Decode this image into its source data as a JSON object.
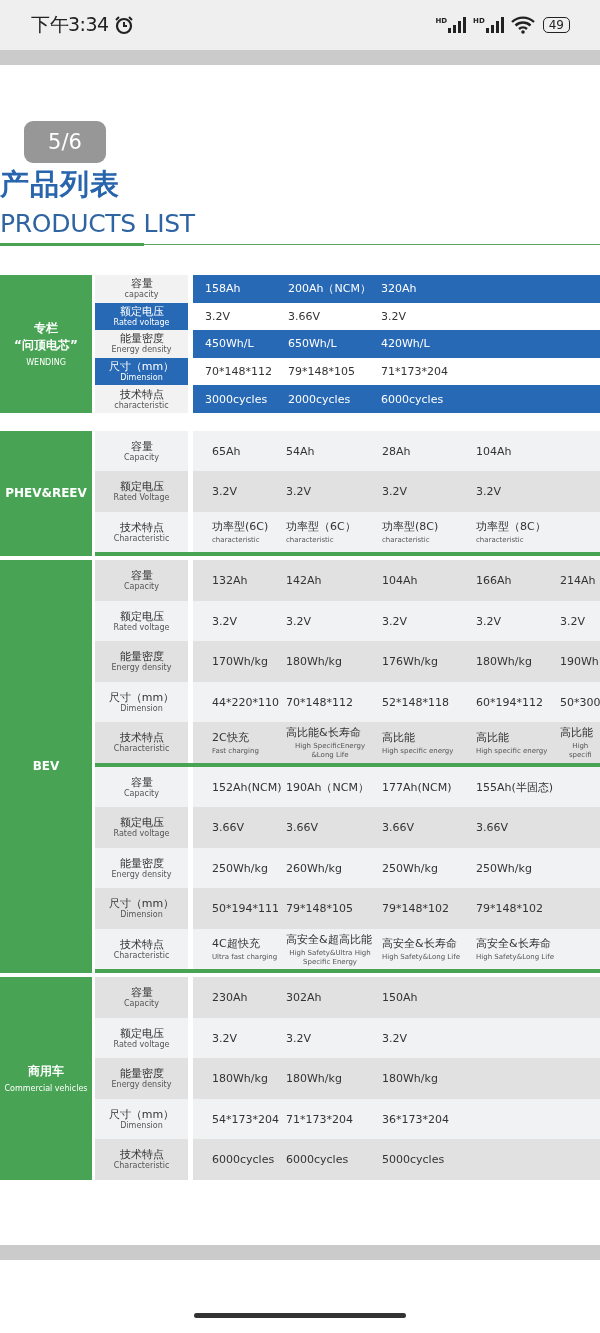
{
  "status_bar": {
    "time": "下午3:34",
    "signal_labels": [
      "HD",
      "HD"
    ],
    "battery": "49"
  },
  "page_badge": "5/6",
  "title_zh": "产品列表",
  "title_en": "PRODUCTS LIST",
  "sections": [
    {
      "kind": "highlight",
      "title_lines": [
        {
          "text": "专栏",
          "kind": "main"
        },
        {
          "text": "“问顶电芯”",
          "kind": "main"
        },
        {
          "text": "WENDING",
          "kind": "sub"
        }
      ],
      "groups": [
        [
          {
            "label": "容量",
            "label_en": "capacity",
            "kind": "blue-values",
            "cells": [
              {
                "value": "158Ah"
              },
              {
                "value": "200Ah（NCM）"
              },
              {
                "value": "320Ah"
              }
            ]
          },
          {
            "label": "额定电压",
            "label_en": "Rated voltage",
            "kind": "blue-label",
            "cells": [
              {
                "value": "3.2V"
              },
              {
                "value": "3.66V"
              },
              {
                "value": "3.2V"
              }
            ]
          },
          {
            "label": "能量密度",
            "label_en": "Energy density",
            "kind": "blue-values",
            "cells": [
              {
                "value": "450Wh/L"
              },
              {
                "value": "650Wh/L"
              },
              {
                "value": "420Wh/L"
              }
            ]
          },
          {
            "label": "尺寸（mm）",
            "label_en": "Dimension",
            "kind": "blue-label",
            "cells": [
              {
                "value": "70*148*112"
              },
              {
                "value": "79*148*105"
              },
              {
                "value": "71*173*204"
              }
            ]
          },
          {
            "label": "技术特点",
            "label_en": "characteristic",
            "kind": "blue-values",
            "cells": [
              {
                "value": "3000cycles"
              },
              {
                "value": "2000cycles"
              },
              {
                "value": "6000cycles"
              }
            ]
          }
        ]
      ]
    },
    {
      "kind": "plain",
      "title_lines": [
        {
          "text": "PHEV&REEV",
          "kind": "main"
        }
      ],
      "groups": [
        [
          {
            "label": "容量",
            "label_en": "Capacity",
            "kind": "light",
            "cells": [
              {
                "value": "65Ah"
              },
              {
                "value": "54Ah"
              },
              {
                "value": "28Ah"
              },
              {
                "value": "104Ah"
              }
            ]
          },
          {
            "label": "额定电压",
            "label_en": "Rated Voltage",
            "kind": "grey",
            "cells": [
              {
                "value": "3.2V"
              },
              {
                "value": "3.2V"
              },
              {
                "value": "3.2V"
              },
              {
                "value": "3.2V"
              }
            ]
          },
          {
            "label": "技术特点",
            "label_en": "Characteristic",
            "kind": "light",
            "cells": [
              {
                "value": "功率型(6C)",
                "note": "characteristic"
              },
              {
                "value": "功率型（6C）",
                "note": "characteristic"
              },
              {
                "value": "功率型(8C)",
                "note": "characteristic"
              },
              {
                "value": "功率型（8C）",
                "note": "characteristic"
              }
            ]
          }
        ]
      ]
    },
    {
      "kind": "plain",
      "title_lines": [
        {
          "text": "BEV",
          "kind": "main"
        }
      ],
      "groups": [
        [
          {
            "label": "容量",
            "label_en": "Capacity",
            "kind": "grey",
            "cells": [
              {
                "value": "132Ah"
              },
              {
                "value": "142Ah"
              },
              {
                "value": "104Ah"
              },
              {
                "value": "166Ah"
              },
              {
                "value": "214Ah"
              }
            ]
          },
          {
            "label": "额定电压",
            "label_en": "Rated voltage",
            "kind": "light",
            "cells": [
              {
                "value": "3.2V"
              },
              {
                "value": "3.2V"
              },
              {
                "value": "3.2V"
              },
              {
                "value": "3.2V"
              },
              {
                "value": "3.2V"
              }
            ]
          },
          {
            "label": "能量密度",
            "label_en": "Energy density",
            "kind": "grey",
            "cells": [
              {
                "value": "170Wh/kg"
              },
              {
                "value": "180Wh/kg"
              },
              {
                "value": "176Wh/kg"
              },
              {
                "value": "180Wh/kg"
              },
              {
                "value": "190Wh"
              }
            ]
          },
          {
            "label": "尺寸（mm）",
            "label_en": "Dimension",
            "kind": "light",
            "cells": [
              {
                "value": "44*220*110"
              },
              {
                "value": "70*148*112"
              },
              {
                "value": "52*148*118"
              },
              {
                "value": "60*194*112"
              },
              {
                "value": "50*300"
              }
            ]
          },
          {
            "label": "技术特点",
            "label_en": "Characteristic",
            "kind": "grey",
            "cells": [
              {
                "value": "2C快充",
                "note": "Fast charging"
              },
              {
                "value": "高比能&长寿命",
                "note": "High SpecificEnergy &Long Life"
              },
              {
                "value": "高比能",
                "note": "High specific energy"
              },
              {
                "value": "高比能",
                "note": "High specific energy"
              },
              {
                "value": "高比能",
                "note": "High specifi"
              }
            ]
          }
        ],
        [
          {
            "label": "容量",
            "label_en": "Capacity",
            "kind": "light",
            "cells": [
              {
                "value": "152Ah(NCM)"
              },
              {
                "value": "190Ah（NCM）"
              },
              {
                "value": "177Ah(NCM)"
              },
              {
                "value": "155Ah(半固态)"
              }
            ]
          },
          {
            "label": "额定电压",
            "label_en": "Rated voltage",
            "kind": "grey",
            "cells": [
              {
                "value": "3.66V"
              },
              {
                "value": "3.66V"
              },
              {
                "value": "3.66V"
              },
              {
                "value": "3.66V"
              }
            ]
          },
          {
            "label": "能量密度",
            "label_en": "Energy density",
            "kind": "light",
            "cells": [
              {
                "value": "250Wh/kg"
              },
              {
                "value": "260Wh/kg"
              },
              {
                "value": "250Wh/kg"
              },
              {
                "value": "250Wh/kg"
              }
            ]
          },
          {
            "label": "尺寸（mm）",
            "label_en": "Dimension",
            "kind": "grey",
            "cells": [
              {
                "value": "50*194*111"
              },
              {
                "value": "79*148*105"
              },
              {
                "value": "79*148*102"
              },
              {
                "value": "79*148*102"
              }
            ]
          },
          {
            "label": "技术特点",
            "label_en": "Characteristic",
            "kind": "light",
            "cells": [
              {
                "value": "4C超快充",
                "note": "Ultra fast charging"
              },
              {
                "value": "高安全&超高比能",
                "note": "High Safety&Ultra High Specific Energy"
              },
              {
                "value": "高安全&长寿命",
                "note": "High Safety&Long Life"
              },
              {
                "value": "高安全&长寿命",
                "note": "High Safety&Long Life"
              }
            ]
          }
        ]
      ]
    },
    {
      "kind": "plain",
      "title_lines": [
        {
          "text": "商用车",
          "kind": "main"
        },
        {
          "text": "Commercial vehicles",
          "kind": "sub"
        }
      ],
      "groups": [
        [
          {
            "label": "容量",
            "label_en": "Capacity",
            "kind": "grey",
            "cells": [
              {
                "value": "230Ah"
              },
              {
                "value": "302Ah"
              },
              {
                "value": "150Ah"
              }
            ]
          },
          {
            "label": "额定电压",
            "label_en": "Rated voltage",
            "kind": "light",
            "cells": [
              {
                "value": "3.2V"
              },
              {
                "value": "3.2V"
              },
              {
                "value": "3.2V"
              }
            ]
          },
          {
            "label": "能量密度",
            "label_en": "Energy density",
            "kind": "grey",
            "cells": [
              {
                "value": "180Wh/kg"
              },
              {
                "value": "180Wh/kg"
              },
              {
                "value": "180Wh/kg"
              }
            ]
          },
          {
            "label": "尺寸（mm）",
            "label_en": "Dimension",
            "kind": "light",
            "cells": [
              {
                "value": "54*173*204"
              },
              {
                "value": "71*173*204"
              },
              {
                "value": "36*173*204"
              }
            ]
          },
          {
            "label": "技术特点",
            "label_en": "Characteristic",
            "kind": "grey",
            "cells": [
              {
                "value": "6000cycles"
              },
              {
                "value": "6000cycles"
              },
              {
                "value": "5000cycles"
              }
            ]
          }
        ]
      ]
    }
  ]
}
